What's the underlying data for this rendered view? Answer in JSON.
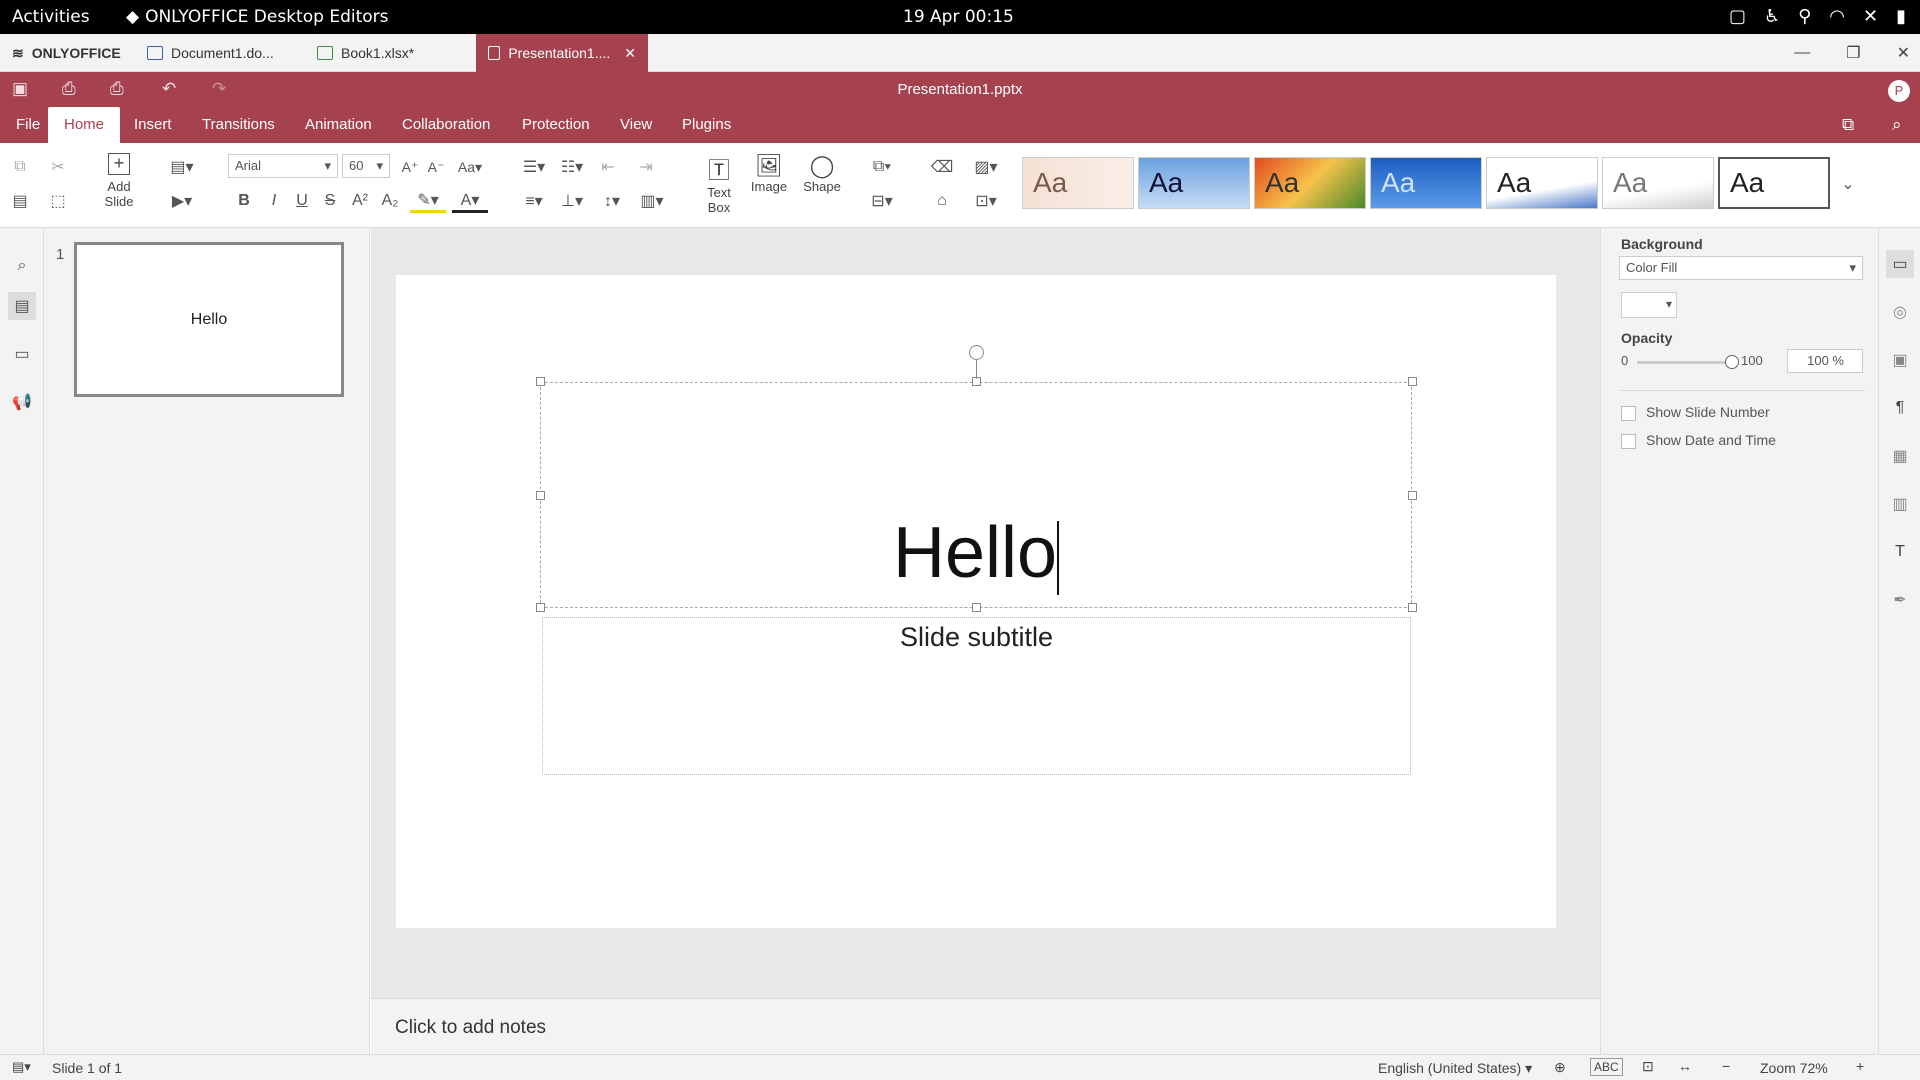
{
  "system": {
    "activities": "Activities",
    "app_name": "ONLYOFFICE Desktop Editors",
    "clock": "19 Apr  00:15"
  },
  "tabs": [
    {
      "label": "ONLYOFFICE"
    },
    {
      "label": "Document1.do..."
    },
    {
      "label": "Book1.xlsx*"
    },
    {
      "label": "Presentation1...."
    }
  ],
  "title": "Presentation1.pptx",
  "avatar": "P",
  "menu": [
    "File",
    "Home",
    "Insert",
    "Transitions",
    "Animation",
    "Collaboration",
    "Protection",
    "View",
    "Plugins"
  ],
  "toolbar": {
    "add_slide": "Add Slide",
    "font_name": "Arial",
    "font_size": "60",
    "text_box": "Text Box",
    "image": "Image",
    "shape": "Shape",
    "theme_sample": "Aa"
  },
  "thumbnail": {
    "number": "1",
    "text": "Hello"
  },
  "slide": {
    "title": "Hello",
    "subtitle": "Slide subtitle"
  },
  "notes_placeholder": "Click to add notes",
  "right_panel": {
    "background_label": "Background",
    "fill_type": "Color Fill",
    "opacity_label": "Opacity",
    "opacity_min": "0",
    "opacity_max": "100",
    "opacity_value": "100 %",
    "opacity_level": 1.0,
    "show_slide_number": "Show Slide Number",
    "show_date_time": "Show Date and Time"
  },
  "status": {
    "slide_info": "Slide 1 of 1",
    "language": "English (United States)",
    "zoom": "Zoom 72%"
  },
  "colors": {
    "accent": "#a6424f",
    "canvas": "#e8e8e8",
    "panel": "#f3f3f3"
  }
}
